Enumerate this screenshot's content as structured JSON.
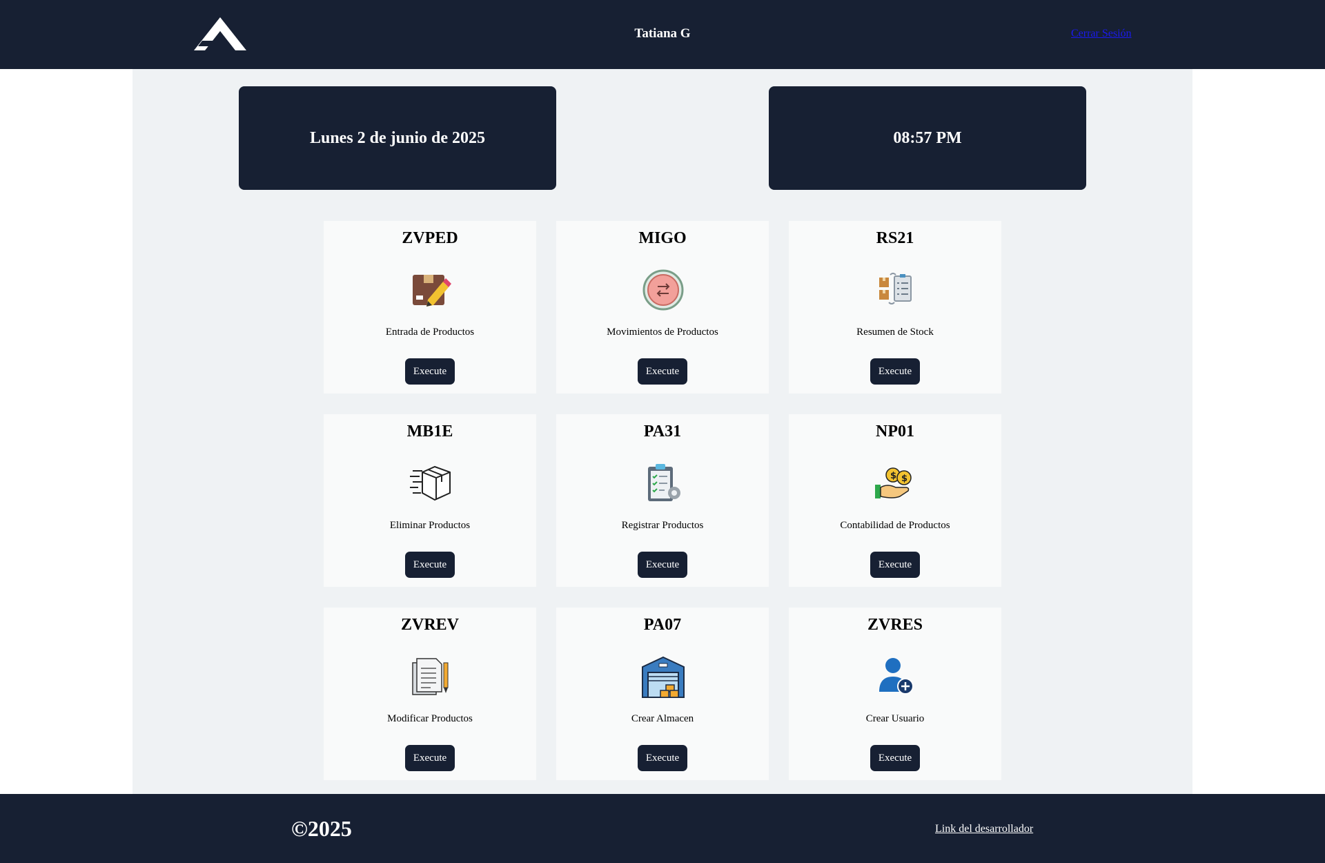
{
  "header": {
    "user_name": "Tatiana G",
    "logout_label": "Cerrar Sesión"
  },
  "info": {
    "date": "Lunes 2 de junio de 2025",
    "time": "08:57 PM"
  },
  "cards": [
    {
      "code": "ZVPED",
      "label": "Entrada de Productos",
      "icon": "box-edit-icon",
      "button": "Execute"
    },
    {
      "code": "MIGO",
      "label": "Movimientos de Productos",
      "icon": "transfer-icon",
      "button": "Execute"
    },
    {
      "code": "RS21",
      "label": "Resumen de Stock",
      "icon": "stock-summary-icon",
      "button": "Execute"
    },
    {
      "code": "MB1E",
      "label": "Eliminar Productos",
      "icon": "box-delete-icon",
      "button": "Execute"
    },
    {
      "code": "PA31",
      "label": "Registrar Productos",
      "icon": "clipboard-settings-icon",
      "button": "Execute"
    },
    {
      "code": "NP01",
      "label": "Contabilidad de Productos",
      "icon": "money-hand-icon",
      "button": "Execute"
    },
    {
      "code": "ZVREV",
      "label": "Modificar Productos",
      "icon": "document-pencil-icon",
      "button": "Execute"
    },
    {
      "code": "PA07",
      "label": "Crear Almacen",
      "icon": "warehouse-icon",
      "button": "Execute"
    },
    {
      "code": "ZVRES",
      "label": "Crear Usuario",
      "icon": "add-user-icon",
      "button": "Execute"
    }
  ],
  "footer": {
    "copyright": "©2025",
    "developer_link": "Link del desarrollador"
  },
  "colors": {
    "navy": "#172033",
    "panel": "#eff2f4",
    "card": "#f9fafa",
    "link": "#1a1aee"
  }
}
